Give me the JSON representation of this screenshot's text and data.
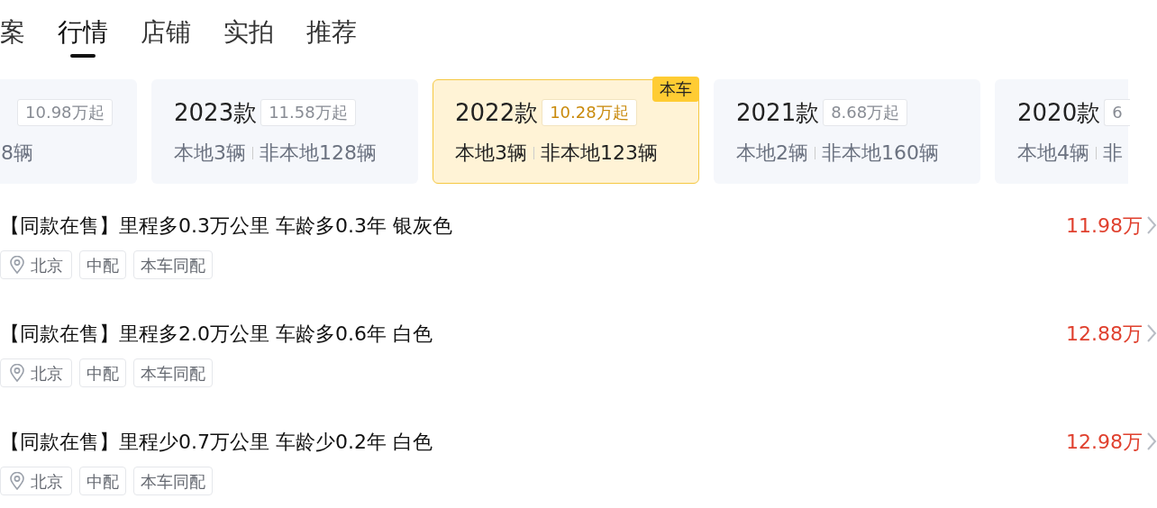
{
  "tabs": [
    {
      "label": "案",
      "selected": false
    },
    {
      "label": "行情",
      "selected": true
    },
    {
      "label": "店铺",
      "selected": false
    },
    {
      "label": "实拍",
      "selected": false
    },
    {
      "label": "推荐",
      "selected": false
    }
  ],
  "models": [
    {
      "price": "10.98万起",
      "nonlocal": "8辆",
      "selected": false
    },
    {
      "year": "2023款",
      "price": "11.58万起",
      "local": "本地3辆",
      "nonlocal": "非本地128辆",
      "selected": false
    },
    {
      "year": "2022款",
      "price": "10.28万起",
      "local": "本地3辆",
      "nonlocal": "非本地123辆",
      "selected": true,
      "tag": "本车"
    },
    {
      "year": "2021款",
      "price": "8.68万起",
      "local": "本地2辆",
      "nonlocal": "非本地160辆",
      "selected": false
    },
    {
      "year": "2020款",
      "price": "6",
      "local": "本地4辆",
      "nonlocal": "非",
      "selected": false
    }
  ],
  "listings": [
    {
      "title": "【同款在售】里程多0.3万公里 车龄多0.3年 银灰色",
      "price": "11.98万",
      "tags": [
        {
          "kind": "location",
          "label": "北京"
        },
        {
          "kind": "plain",
          "label": "中配"
        },
        {
          "kind": "plain",
          "label": "本车同配"
        }
      ]
    },
    {
      "title": "【同款在售】里程多2.0万公里 车龄多0.6年 白色",
      "price": "12.88万",
      "tags": [
        {
          "kind": "location",
          "label": "北京"
        },
        {
          "kind": "plain",
          "label": "中配"
        },
        {
          "kind": "plain",
          "label": "本车同配"
        }
      ]
    },
    {
      "title": "【同款在售】里程少0.7万公里 车龄少0.2年 白色",
      "price": "12.98万",
      "tags": [
        {
          "kind": "location",
          "label": "北京"
        },
        {
          "kind": "plain",
          "label": "中配"
        },
        {
          "kind": "plain",
          "label": "本车同配"
        }
      ]
    }
  ]
}
